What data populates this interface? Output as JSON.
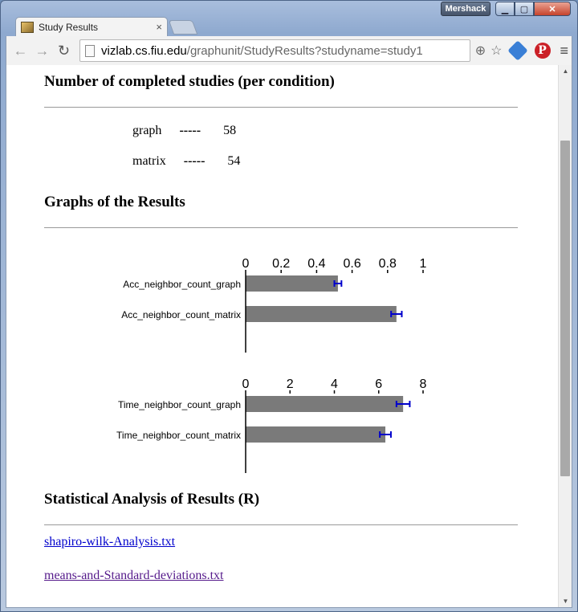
{
  "window": {
    "profile_name": "Mershack",
    "min_icon": "minimize-icon",
    "max_icon": "maximize-icon",
    "close_icon": "close-icon"
  },
  "tab": {
    "title": "Study Results",
    "close": "×"
  },
  "toolbar": {
    "url_host": "vizlab.cs.fiu.edu",
    "url_path": "/graphunit/StudyResults?studyname=study1",
    "back": "←",
    "forward": "→",
    "reload": "↻",
    "zoom": "⊕",
    "star": "☆",
    "menu": "≡",
    "pin": "P"
  },
  "page": {
    "completed_heading": "Number of completed studies (per condition)",
    "conditions": [
      {
        "name": "graph",
        "sep": "-----",
        "count": "58"
      },
      {
        "name": "matrix",
        "sep": "-----",
        "count": "54"
      }
    ],
    "graphs_heading": "Graphs of the Results",
    "stats_heading": "Statistical Analysis of Results (R)",
    "links": [
      {
        "label": "shapiro-wilk-Analysis.txt"
      },
      {
        "label": "means-and-Standard-deviations.txt"
      }
    ]
  },
  "chart_data": [
    {
      "type": "bar",
      "orientation": "horizontal",
      "categories": [
        "Acc_neighbor_count_graph",
        "Acc_neighbor_count_matrix"
      ],
      "values": [
        0.52,
        0.85
      ],
      "error": [
        0.02,
        0.03
      ],
      "xlim": [
        0,
        1
      ],
      "ticks": [
        "0",
        "0.2",
        "0.4",
        "0.6",
        "0.8",
        "1"
      ],
      "tick_values": [
        0,
        0.2,
        0.4,
        0.6,
        0.8,
        1
      ],
      "bar_color": "#7a7a7a",
      "error_color": "#0000cc"
    },
    {
      "type": "bar",
      "orientation": "horizontal",
      "categories": [
        "Time_neighbor_count_graph",
        "Time_neighbor_count_matrix"
      ],
      "values": [
        7.1,
        6.3
      ],
      "error": [
        0.3,
        0.25
      ],
      "xlim": [
        0,
        8
      ],
      "ticks": [
        "0",
        "2",
        "4",
        "6",
        "8"
      ],
      "tick_values": [
        0,
        2,
        4,
        6,
        8
      ],
      "bar_color": "#7a7a7a",
      "error_color": "#0000cc"
    }
  ]
}
